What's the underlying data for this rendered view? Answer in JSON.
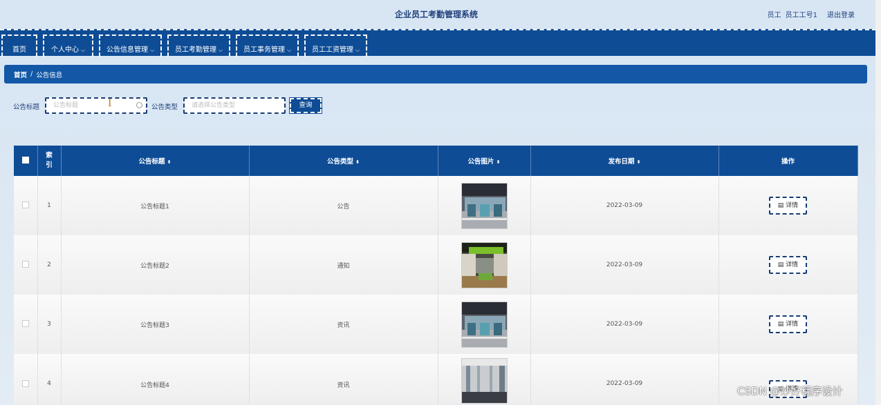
{
  "header": {
    "title": "企业员工考勤管理系统",
    "user_role": "员工",
    "user_name": "员工工号1",
    "logout": "退出登录"
  },
  "nav": [
    {
      "label": "首页",
      "has_menu": false
    },
    {
      "label": "个人中心",
      "has_menu": true
    },
    {
      "label": "公告信息管理",
      "has_menu": true
    },
    {
      "label": "员工考勤管理",
      "has_menu": true
    },
    {
      "label": "员工事务管理",
      "has_menu": true
    },
    {
      "label": "员工工资管理",
      "has_menu": true
    }
  ],
  "breadcrumb": {
    "home": "首页",
    "separator": "/",
    "current": "公告信息"
  },
  "search": {
    "title_label": "公告标题",
    "title_placeholder": "公告标题",
    "type_label": "公告类型",
    "type_placeholder": "请选择公告类型",
    "query_button": "查询"
  },
  "table": {
    "headers": {
      "index": "索引",
      "title": "公告标题",
      "type": "公告类型",
      "image": "公告图片",
      "date": "发布日期",
      "action": "操作"
    },
    "rows": [
      {
        "index": "1",
        "title": "公告标题1",
        "type": "公告",
        "date": "2022-03-09",
        "action": "详情"
      },
      {
        "index": "2",
        "title": "公告标题2",
        "type": "通知",
        "date": "2022-03-09",
        "action": "详情"
      },
      {
        "index": "3",
        "title": "公告标题3",
        "type": "资讯",
        "date": "2022-03-09",
        "action": "详情"
      },
      {
        "index": "4",
        "title": "公告标题4",
        "type": "资讯",
        "date": "2022-03-09",
        "action": "详情"
      }
    ]
  },
  "watermark": "CSDN @炒好程序设计",
  "colors": {
    "nav": "#0e4c96",
    "breadcrumb": "#1258a7",
    "page_bg": "#d6e6f5"
  }
}
